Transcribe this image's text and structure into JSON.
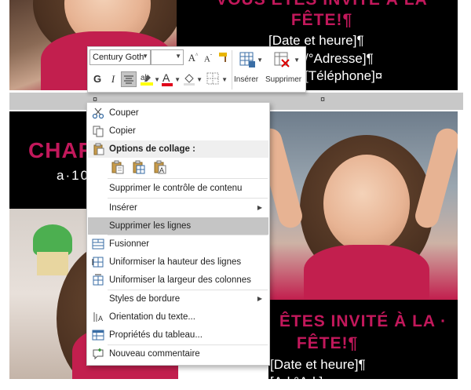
{
  "document": {
    "top_title_partial": "VOUS ÊTES INVITÉ À LA",
    "top_fete": "FÊTE!¶",
    "top_date": "[Date et heure]¶",
    "top_address": "/°Adresse]¶",
    "top_phone": "[Téléphone]¤",
    "cell_marker_left": "¤",
    "cell_marker_right": "¤",
    "left_title_partial": "CHAR",
    "left_sub_partial": "a·10",
    "bottom_title": "ÊTES INVITÉ À LA ·",
    "bottom_fete": "FÊTE!¶",
    "bottom_date": "[Date et heure]¶",
    "bottom_address_partial": "[Ad  °Ad   ]"
  },
  "mini_toolbar": {
    "font_name": "Century Goth",
    "font_size": "",
    "grow_font": "A",
    "shrink_font": "A",
    "bold": "G",
    "italic": "I",
    "font_color_glyph": "A",
    "insert_label": "Insérer",
    "delete_label": "Supprimer"
  },
  "context_menu": {
    "items": [
      {
        "label": "Couper",
        "icon": "scissors-icon"
      },
      {
        "label": "Copier",
        "icon": "copy-icon"
      },
      {
        "label": "Options de collage :",
        "icon": "paste-icon"
      },
      {
        "label": "Supprimer le contrôle de contenu"
      },
      {
        "label": "Insérer",
        "submenu": true
      },
      {
        "label": "Supprimer les lignes",
        "highlighted": true
      },
      {
        "label": "Fusionner",
        "icon": "merge-cells-icon"
      },
      {
        "label": "Uniformiser la hauteur des lignes",
        "icon": "distribute-rows-icon"
      },
      {
        "label": "Uniformiser la largeur des colonnes",
        "icon": "distribute-columns-icon"
      },
      {
        "label": "Styles de bordure",
        "submenu": true
      },
      {
        "label": "Orientation du texte...",
        "icon": "text-direction-icon"
      },
      {
        "label": "Propriétés du tableau...",
        "icon": "table-properties-icon"
      },
      {
        "label": "Nouveau commentaire",
        "icon": "comment-icon"
      }
    ]
  },
  "colors": {
    "title_pink": "#c2185b",
    "menu_highlight": "#c5c5c5"
  }
}
